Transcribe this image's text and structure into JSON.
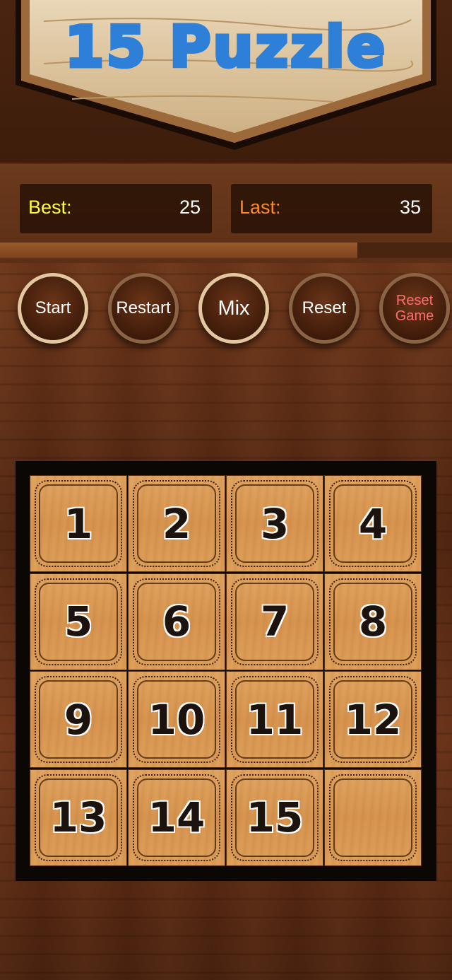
{
  "header": {
    "title": "15 Puzzle"
  },
  "scores": {
    "best_label": "Best:",
    "best_value": "25",
    "last_label": "Last:",
    "last_value": "35",
    "best_color": "#ffff33",
    "last_color": "#ff8a1e"
  },
  "progress": {
    "fraction": 0.79
  },
  "buttons": {
    "start": "Start",
    "restart": "Restart",
    "mix": "Mix",
    "reset": "Reset",
    "reset_game_line1": "Reset",
    "reset_game_line2": "Game"
  },
  "board": {
    "tiles": [
      "1",
      "2",
      "3",
      "4",
      "5",
      "6",
      "7",
      "8",
      "9",
      "10",
      "11",
      "12",
      "13",
      "14",
      "15",
      ""
    ]
  }
}
